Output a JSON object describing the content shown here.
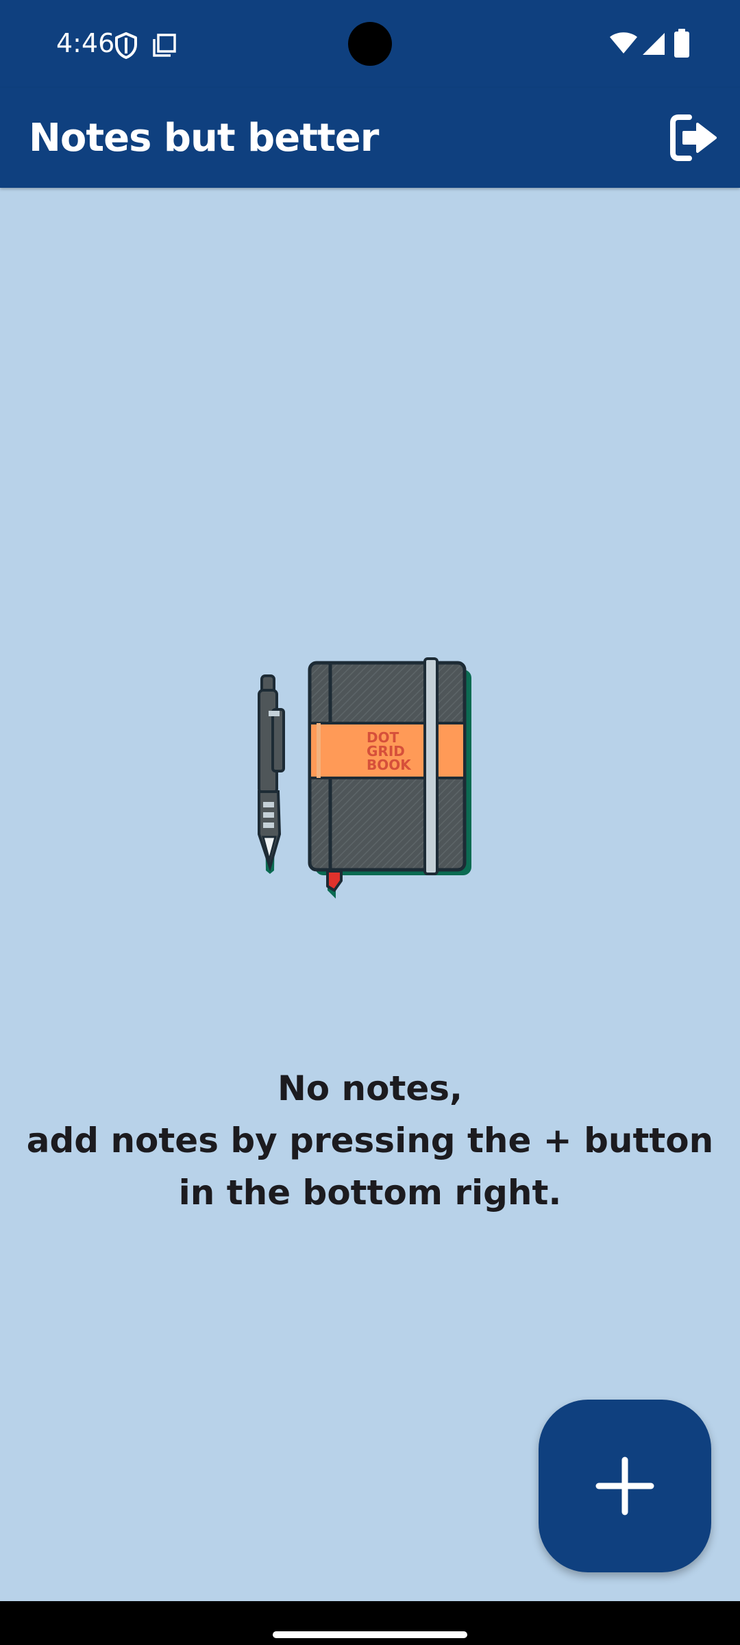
{
  "status_bar": {
    "time": "4:46",
    "left_icons": [
      "shield-icon",
      "copy-icon"
    ],
    "right_icons": [
      "wifi-icon",
      "signal-icon",
      "battery-icon"
    ]
  },
  "app_bar": {
    "title": "Notes but better",
    "action_icon": "logout-icon"
  },
  "empty_state": {
    "illustration": {
      "book_label": [
        "DOT",
        "GRID",
        "BOOK"
      ]
    },
    "message_lines": [
      "No notes,",
      "add notes by pressing the + button",
      "in the bottom right."
    ]
  },
  "fab": {
    "icon": "plus-icon"
  },
  "colors": {
    "primary": "#0f407f",
    "background": "#b8d2e9",
    "text": "#1c1b1f",
    "on_primary": "#ffffff"
  }
}
